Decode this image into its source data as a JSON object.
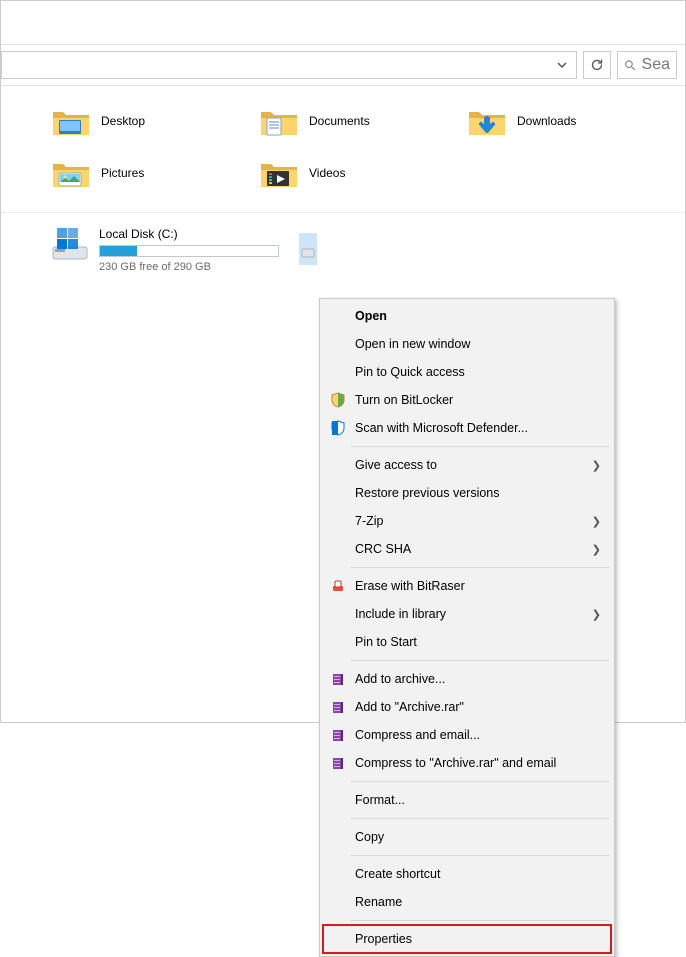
{
  "address": {
    "refresh_tip": "Refresh",
    "history_tip": "History"
  },
  "search": {
    "placeholder": "Sea"
  },
  "folders": [
    {
      "name": "Desktop",
      "accent": "desktop"
    },
    {
      "name": "Documents",
      "accent": "documents"
    },
    {
      "name": "Downloads",
      "accent": "downloads"
    },
    {
      "name": "Pictures",
      "accent": "pictures"
    },
    {
      "name": "Videos",
      "accent": "videos"
    }
  ],
  "drives": {
    "c": {
      "name": "Local Disk (C:)",
      "free_text": "230 GB free of 290 GB",
      "fill_pct": 21
    }
  },
  "ctx": {
    "open": "Open",
    "open_new": "Open in new window",
    "pin_qa": "Pin to Quick access",
    "bitlocker": "Turn on BitLocker",
    "defender": "Scan with Microsoft Defender...",
    "give_access": "Give access to",
    "restore_prev": "Restore previous versions",
    "sevenzip": "7-Zip",
    "crcsha": "CRC SHA",
    "bitraser": "Erase with BitRaser",
    "include_lib": "Include in library",
    "pin_start": "Pin to Start",
    "add_archive": "Add to archive...",
    "add_archive_rar": "Add to \"Archive.rar\"",
    "compress_email": "Compress and email...",
    "compress_rar_email": "Compress to \"Archive.rar\" and email",
    "format": "Format...",
    "copy": "Copy",
    "create_shortcut": "Create shortcut",
    "rename": "Rename",
    "properties": "Properties"
  },
  "colors": {
    "folder_base": "#ffd46b",
    "folder_shadow": "#e6b24a",
    "accent_blue": "#26a0da",
    "highlight_red": "#d71b1b"
  }
}
